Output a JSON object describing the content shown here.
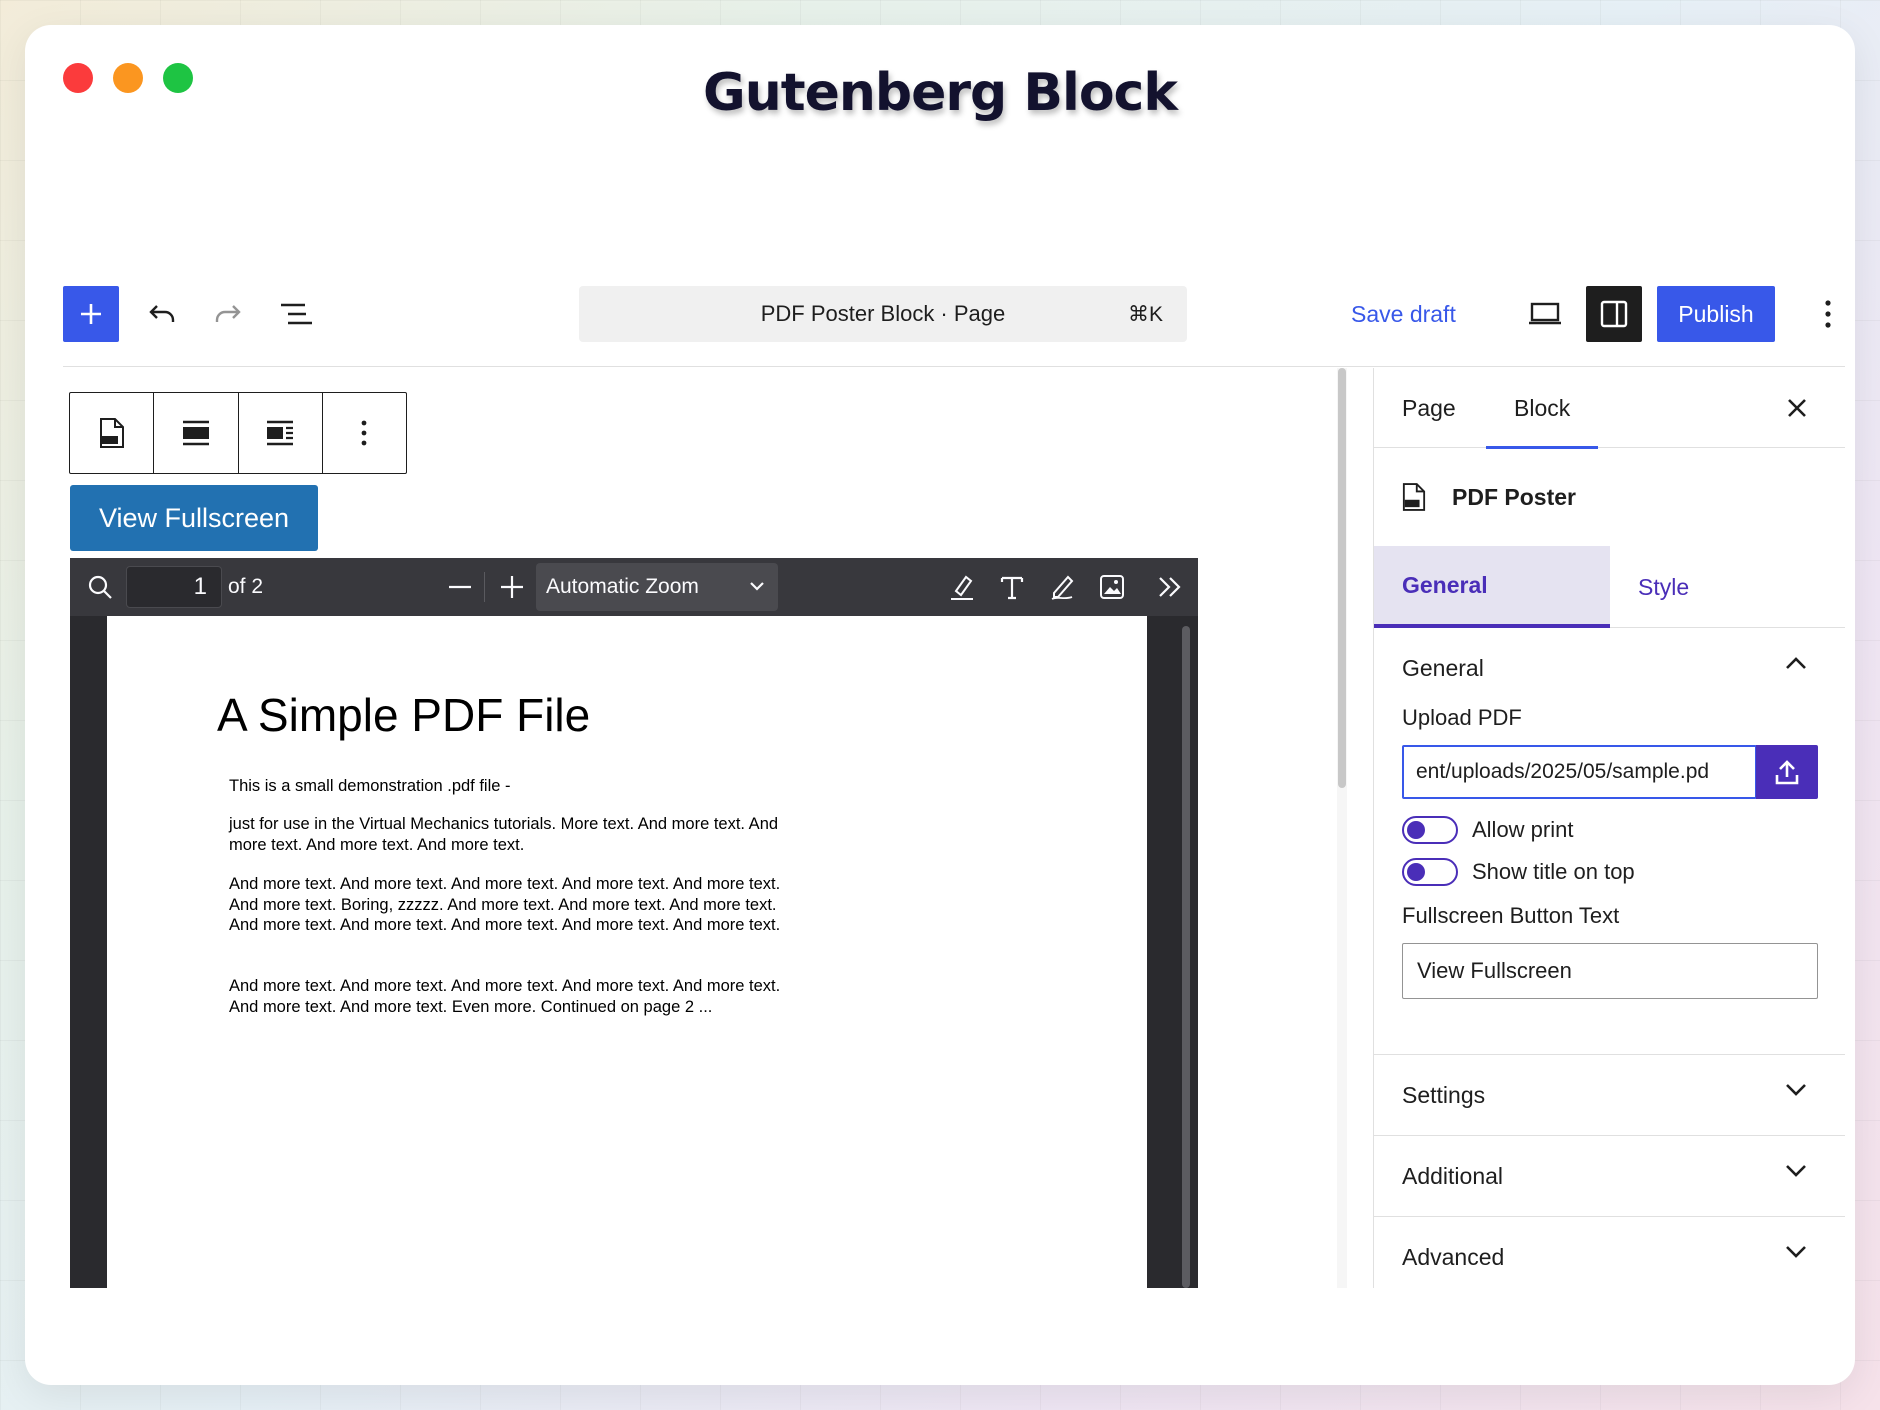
{
  "window": {
    "title": "Gutenberg Block"
  },
  "topbar": {
    "command_label": "PDF Poster Block · Page",
    "command_shortcut": "⌘K",
    "save_draft": "Save draft",
    "publish": "Publish"
  },
  "canvas": {
    "fullscreen_button": "View Fullscreen",
    "viewer": {
      "page_number": "1",
      "page_count": "of 2",
      "zoom": "Automatic Zoom"
    },
    "pdf": {
      "title": "A Simple PDF File",
      "paragraphs": [
        "This is a small demonstration .pdf file -",
        "just for use in the Virtual Mechanics tutorials. More text. And more text. And more text. And more text. And more text.",
        "And more text. And more text. And more text. And more text. And more text. And more text. Boring, zzzzz. And more text. And more text. And more text. And more text. And more text. And more text. And more text. And more text.",
        "And more text. And more text. And more text. And more text. And more text. And more text. And more text. Even more. Continued on page 2 ..."
      ]
    }
  },
  "sidebar": {
    "tabs": [
      "Page",
      "Block"
    ],
    "block_name": "PDF Poster",
    "subtabs": [
      "General",
      "Style"
    ],
    "general_panel": {
      "title": "General",
      "upload_label": "Upload PDF",
      "upload_value": "ent/uploads/2025/05/sample.pd",
      "allow_print": "Allow print",
      "show_title": "Show title on top",
      "fullscreen_label": "Fullscreen Button Text",
      "fullscreen_value": "View Fullscreen"
    },
    "panels": [
      "Settings",
      "Additional",
      "Advanced"
    ]
  },
  "colors": {
    "wp_blue": "#3858e9",
    "accent_purple": "#4a2eb8",
    "fullscreen_blue": "#2271b1"
  }
}
